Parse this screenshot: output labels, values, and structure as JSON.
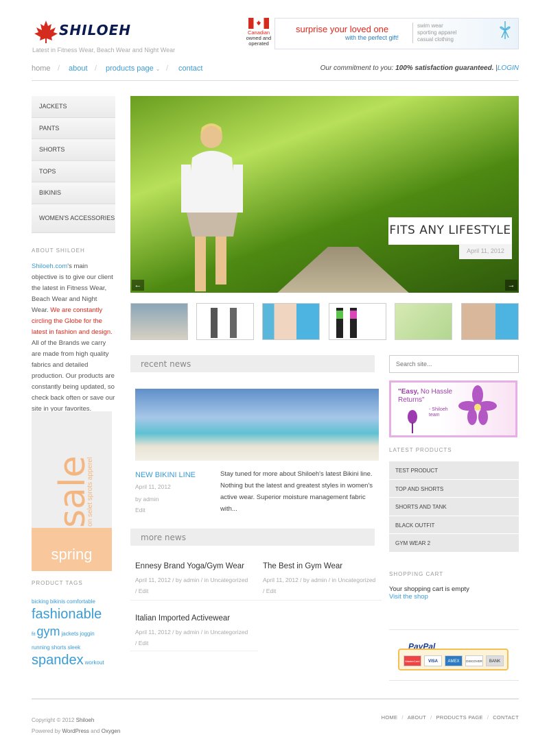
{
  "header": {
    "logo_text": "SHILOEH",
    "tagline": "Latest in Fitness Wear, Beach Wear and Night Wear",
    "canada_line1": "Canadian",
    "canada_line2": "owned and",
    "canada_line3": "operated",
    "banner_line1": "surprise your loved one",
    "banner_line2": "with the perfect gift!",
    "banner_right1": "swim wear",
    "banner_right2": "sporting apparel",
    "banner_right3": "casual clothing"
  },
  "nav": {
    "home": "home",
    "about": "about",
    "products": "products page",
    "contact": "contact",
    "sep": "/",
    "commitment_prefix": "Our commitment to you:",
    "commitment_bold": "100% satisfaction guaranteed.",
    "login_sep": "|",
    "login": "LOGIN"
  },
  "sidebar": {
    "menu": [
      "JACKETS",
      "PANTS",
      "SHORTS",
      "TOPS",
      "BIKINIS",
      "WOMEN'S ACCESSORIES"
    ],
    "about_head": "ABOUT SHILOEH",
    "about_link": "Shiloeh.com",
    "about_1": "'s main objective is to give our client the latest in Fitness Wear, Beach Wear and Night Wear.",
    "about_red": "We are constantly circling the Globe for the latest in fashion and design.",
    "about_2": "All of the Brands we carry are made from high quality fabrics and detailed production. Our products are constantly being updated, so check back often or save our site in your favorites.",
    "sale_word": "sale",
    "sale_sub": "on selet sprots apperel",
    "sale_spring": "spring",
    "tags_head": "PRODUCT TAGS",
    "tags": {
      "t1": "bicking",
      "t2": "bikinis",
      "t3": "comfortable",
      "t4": "fashionable",
      "t5": "fit",
      "t6": "gym",
      "t7": "jackets",
      "t8": "joggin",
      "t9": "running",
      "t10": "shorts",
      "t11": "sleek",
      "t12": "spandex",
      "t13": "workout"
    }
  },
  "slider": {
    "caption": "FITS ANY LIFESTYLE",
    "date": "April 11, 2012",
    "prev": "←",
    "next": "→"
  },
  "recent": {
    "head": "recent news",
    "post_title": "NEW BIKINI LINE",
    "post_date": "April 11, 2012",
    "post_by": "by  admin",
    "post_edit": "Edit",
    "post_excerpt": "Stay tuned for more about Shiloeh's latest Bikini line. Nothing but the latest and greatest styles in women's active wear. Superior moisture management fabric with..."
  },
  "more": {
    "head": "more news",
    "items": [
      {
        "title": "Ennesy Brand Yoga/Gym Wear",
        "meta1": "April 11, 2012  /  by  admin  /  in Uncategorized",
        "meta2": "/  Edit"
      },
      {
        "title": "The Best in Gym Wear",
        "meta1": "April 11, 2012  /  by  admin  /  in Uncategorized",
        "meta2": "/  Edit"
      },
      {
        "title": "Italian Imported Activewear",
        "meta1": "April 11, 2012  /  by  admin  /  in Uncategorized",
        "meta2": "/  Edit"
      }
    ]
  },
  "right": {
    "search_placeholder": "Search site...",
    "easy_line1": "\"Easy,",
    "easy_line1b": " No Hassle",
    "easy_line2": "Returns\"",
    "easy_sign1": "- Shiloeh",
    "easy_sign2": "team",
    "latest_head": "LATEST PRODUCTS",
    "latest": [
      "TEST PRODUCT",
      "TOP AND SHORTS",
      "SHORTS AND TANK",
      "BLACK OUTFIT",
      "GYM WEAR 2"
    ],
    "cart_head": "SHOPPING CART",
    "cart_empty": "Your shopping cart is empty",
    "cart_link": "Visit the shop",
    "paypal": "PayPal",
    "cards": [
      "MasterCard",
      "VISA",
      "AMEX",
      "DISCOVER",
      "BANK"
    ]
  },
  "footer": {
    "copyright": "Copyright © 2012",
    "copyright_link": "Shiloeh",
    "powered": "Powered by",
    "wp": "WordPress",
    "and": "and",
    "oxygen": "Oxygen",
    "nav": [
      "HOME",
      "ABOUT",
      "PRODUCTS PAGE",
      "CONTACT"
    ]
  },
  "colors": {
    "accent": "#3a9bd5",
    "red": "#e0261b",
    "navy": "#0b1b4f"
  }
}
